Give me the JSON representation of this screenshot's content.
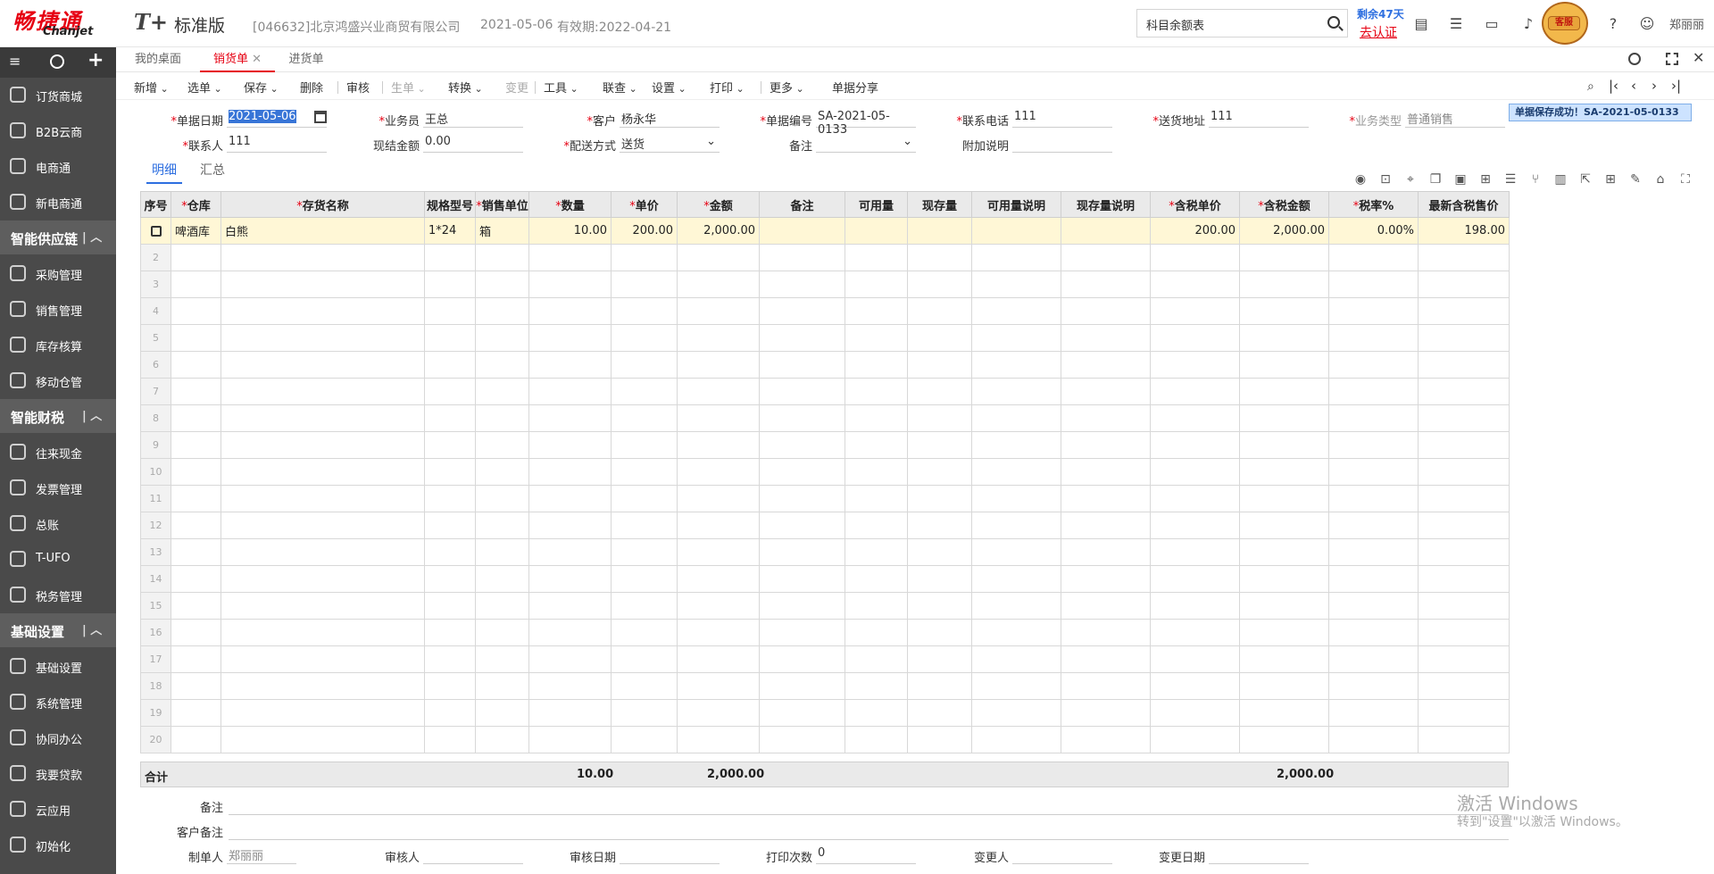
{
  "header": {
    "logo_cn": "畅捷通",
    "logo_en": "Chanjet",
    "product": "T+",
    "edition": "标准版",
    "company": "[046632]北京鸿盛兴业商贸有限公司",
    "date": "2021-05-06",
    "expire": "有效期:2022-04-21",
    "search_placeholder": "科目余额表",
    "remain": "剩余47天",
    "certify": "去认证",
    "mascot_label": "客服",
    "user": "郑丽丽"
  },
  "sidebar": {
    "items": [
      {
        "label": "订货商城",
        "type": "item"
      },
      {
        "label": "B2B云商",
        "type": "item"
      },
      {
        "label": "电商通",
        "type": "item"
      },
      {
        "label": "新电商通",
        "type": "item"
      },
      {
        "label": "智能供应链",
        "type": "group"
      },
      {
        "label": "采购管理",
        "type": "item"
      },
      {
        "label": "销售管理",
        "type": "item"
      },
      {
        "label": "库存核算",
        "type": "item"
      },
      {
        "label": "移动仓管",
        "type": "item"
      },
      {
        "label": "智能财税",
        "type": "group"
      },
      {
        "label": "往来现金",
        "type": "item"
      },
      {
        "label": "发票管理",
        "type": "item"
      },
      {
        "label": "总账",
        "type": "item"
      },
      {
        "label": "T-UFO",
        "type": "item"
      },
      {
        "label": "税务管理",
        "type": "item"
      },
      {
        "label": "基础设置",
        "type": "group"
      },
      {
        "label": "基础设置",
        "type": "item"
      },
      {
        "label": "系统管理",
        "type": "item"
      },
      {
        "label": "协同办公",
        "type": "item"
      },
      {
        "label": "我要贷款",
        "type": "item"
      },
      {
        "label": "云应用",
        "type": "item"
      },
      {
        "label": "初始化",
        "type": "item"
      }
    ]
  },
  "tabs": {
    "desktop": "我的桌面",
    "sales": "销货单",
    "purchase": "进货单"
  },
  "toolbar": {
    "items": [
      "新增",
      "选单",
      "保存",
      "删除",
      "审核",
      "生单",
      "转换",
      "变更",
      "工具",
      "联查",
      "设置",
      "打印",
      "更多",
      "单据分享"
    ]
  },
  "form": {
    "doc_date_label": "单据日期",
    "doc_date": "2021-05-06",
    "salesman_label": "业务员",
    "salesman": "王总",
    "customer_label": "客户",
    "customer": "杨永华",
    "doc_no_label": "单据编号",
    "doc_no": "SA-2021-05-0133",
    "phone_label": "联系电话",
    "phone": "111",
    "address_label": "送货地址",
    "address": "111",
    "biz_type_label": "业务类型",
    "biz_type": "普通销售",
    "contact_label": "联系人",
    "contact": "111",
    "cash_label": "现结金额",
    "cash": "0.00",
    "delivery_label": "配送方式",
    "delivery": "送货",
    "remark_label": "备注",
    "remark": "",
    "extra_label": "附加说明",
    "extra": ""
  },
  "toast": "单据保存成功！SA-2021-05-0133",
  "subtabs": {
    "detail": "明细",
    "summary": "汇总"
  },
  "grid": {
    "headers": [
      {
        "label": "序号",
        "req": false
      },
      {
        "label": "仓库",
        "req": true
      },
      {
        "label": "存货名称",
        "req": true
      },
      {
        "label": "规格型号",
        "req": false
      },
      {
        "label": "销售单位",
        "req": true
      },
      {
        "label": "数量",
        "req": true
      },
      {
        "label": "单价",
        "req": true
      },
      {
        "label": "金额",
        "req": true
      },
      {
        "label": "备注",
        "req": false
      },
      {
        "label": "可用量",
        "req": false
      },
      {
        "label": "现存量",
        "req": false
      },
      {
        "label": "可用量说明",
        "req": false
      },
      {
        "label": "现存量说明",
        "req": false
      },
      {
        "label": "含税单价",
        "req": true
      },
      {
        "label": "含税金额",
        "req": true
      },
      {
        "label": "税率%",
        "req": true
      },
      {
        "label": "最新含税售价",
        "req": false
      }
    ],
    "row1": {
      "warehouse": "啤酒库",
      "name": "白熊",
      "spec": "1*24",
      "unit": "箱",
      "qty": "10.00",
      "price": "200.00",
      "amount": "2,000.00",
      "tax_price": "200.00",
      "tax_amount": "2,000.00",
      "tax_rate": "0.00%",
      "latest_price": "198.00"
    },
    "row_numbers": [
      "2",
      "3",
      "4",
      "5",
      "6",
      "7",
      "8",
      "9",
      "10",
      "11",
      "12",
      "13",
      "14",
      "15",
      "16",
      "17",
      "18",
      "19",
      "20"
    ],
    "total_label": "合计",
    "total_qty": "10.00",
    "total_amount": "2,000.00",
    "total_tax_amount": "2,000.00"
  },
  "footer": {
    "remark_label": "备注",
    "cust_remark_label": "客户备注",
    "maker_label": "制单人",
    "maker": "郑丽丽",
    "reviewer_label": "审核人",
    "review_date_label": "审核日期",
    "print_count_label": "打印次数",
    "print_count": "0",
    "changer_label": "变更人",
    "change_date_label": "变更日期"
  },
  "watermark": {
    "line1": "激活 Windows",
    "line2": "转到\"设置\"以激活 Windows。"
  }
}
